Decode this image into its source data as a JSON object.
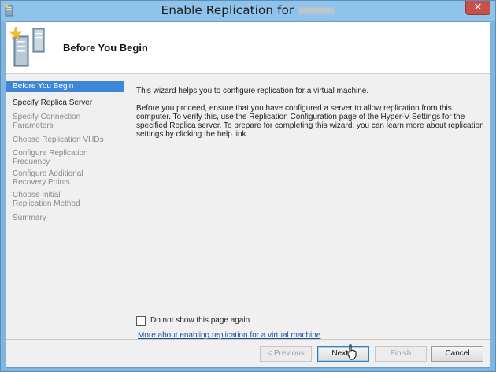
{
  "window": {
    "title": "Enable Replication for",
    "close_label": "✕"
  },
  "header": {
    "title": "Before You Begin"
  },
  "sidebar": {
    "items": [
      {
        "label": "Before You Begin",
        "state": "active"
      },
      {
        "label": "Specify Replica Server",
        "state": "enabled"
      },
      {
        "label": "Specify Connection Parameters",
        "state": "disabled"
      },
      {
        "label": "Choose Replication VHDs",
        "state": "disabled"
      },
      {
        "label": "Configure Replication Frequency",
        "state": "disabled"
      },
      {
        "label": "Configure Additional Recovery Points",
        "state": "disabled"
      },
      {
        "label": "Choose Initial Replication Method",
        "state": "disabled"
      },
      {
        "label": "Summary",
        "state": "disabled"
      }
    ]
  },
  "content": {
    "intro": "This wizard helps you to configure replication for a virtual machine.",
    "paragraph": "Before you proceed, ensure that you have configured a server to allow replication from this computer. To verify this, use the Replication Configuration page of the Hyper-V Settings for the specified Replica server. To prepare for completing this wizard, you can learn more about replication settings by clicking the help link.",
    "checkbox_label": "Do not show this page again.",
    "checkbox_checked": false,
    "help_link": "More about enabling replication for a virtual machine"
  },
  "footer": {
    "previous": "< Previous",
    "next": "Next >",
    "finish": "Finish",
    "cancel": "Cancel"
  },
  "colors": {
    "title_bar": "#8fc3ea",
    "selection": "#3e87d8",
    "link": "#1a4f9c",
    "close_button": "#c7504a"
  }
}
